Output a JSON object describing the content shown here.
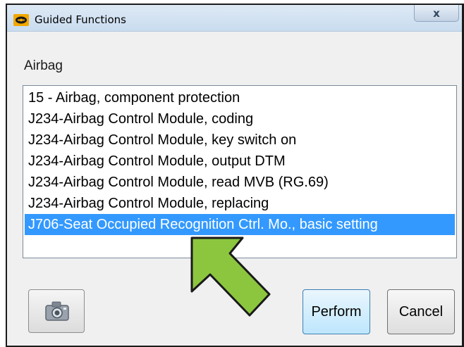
{
  "window": {
    "title": "Guided Functions",
    "close_label": "x"
  },
  "group": {
    "label": "Airbag"
  },
  "functions": {
    "items": [
      {
        "label": "15 - Airbag, component protection",
        "selected": false
      },
      {
        "label": "J234-Airbag Control Module, coding",
        "selected": false
      },
      {
        "label": "J234-Airbag Control Module, key switch on",
        "selected": false
      },
      {
        "label": "J234-Airbag Control Module, output DTM",
        "selected": false
      },
      {
        "label": "J234-Airbag Control Module, read MVB (RG.69)",
        "selected": false
      },
      {
        "label": "J234-Airbag Control Module, replacing",
        "selected": false
      },
      {
        "label": "J706-Seat Occupied Recognition Ctrl. Mo., basic setting",
        "selected": true
      }
    ]
  },
  "buttons": {
    "perform_label": "Perform",
    "cancel_label": "Cancel",
    "camera_icon": "camera-icon"
  },
  "colors": {
    "selection": "#3399ff",
    "arrow_fill": "#8cc63f",
    "arrow_stroke": "#1a1a1a"
  }
}
